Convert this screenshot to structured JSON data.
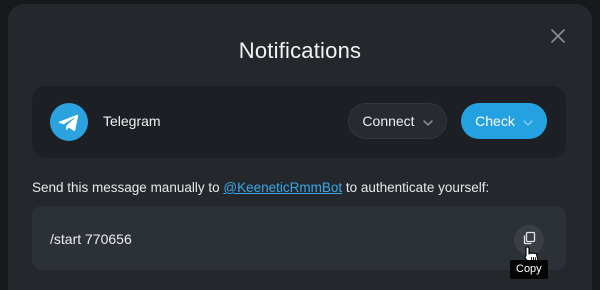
{
  "modal": {
    "title": "Notifications"
  },
  "service": {
    "name": "Telegram",
    "icon": "telegram-icon",
    "connect_label": "Connect",
    "check_label": "Check"
  },
  "instruction": {
    "prefix": "Send this message manually to ",
    "bot_link": "@KeeneticRmmBot",
    "suffix": " to authenticate yourself:"
  },
  "code": {
    "value": "/start 770656",
    "copy_icon": "copy-icon"
  },
  "tooltip": {
    "text": "Copy"
  },
  "colors": {
    "accent": "#24a1e0",
    "link": "#38a8e8",
    "telegram": "#2aa3df",
    "modal_bg": "#24272c"
  }
}
